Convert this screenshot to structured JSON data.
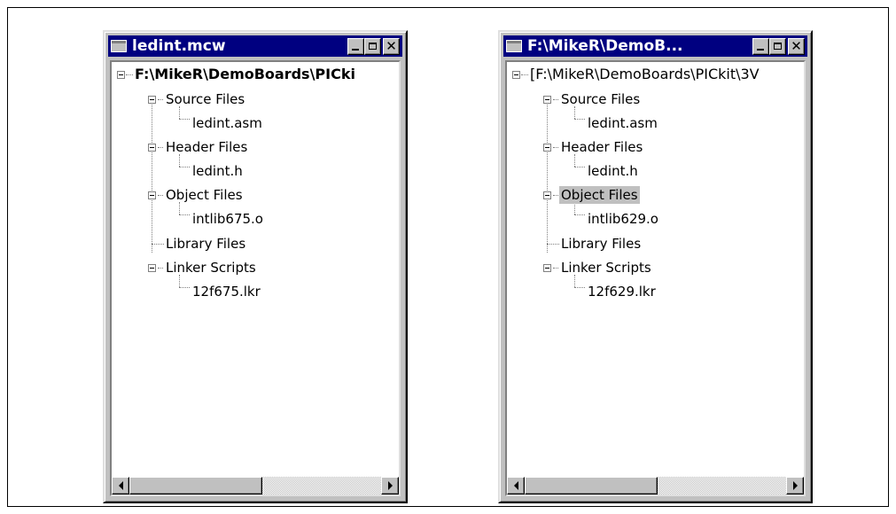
{
  "windows": [
    {
      "title": "ledint.mcw",
      "root": "F:\\MikeR\\DemoBoards\\PICki",
      "items": [
        "Source Files",
        "ledint.asm",
        "Header Files",
        "ledint.h",
        "Object Files",
        "intlib675.o",
        "Library Files",
        "Linker Scripts",
        "12f675.lkr"
      ]
    },
    {
      "title": "F:\\MikeR\\DemoB...",
      "root": "[F:\\MikeR\\DemoBoards\\PICkit\\3V",
      "items": [
        "Source Files",
        "ledint.asm",
        "Header Files",
        "ledint.h",
        "Object Files",
        "intlib629.o",
        "Library Files",
        "Linker Scripts",
        "12f629.lkr"
      ],
      "selected_item": "Object Files"
    }
  ],
  "icons": {
    "window_icon": "window-icon",
    "minimize": "minimize-icon",
    "maximize": "maximize-icon",
    "close": "close-icon",
    "scroll_left": "arrow-left-icon",
    "scroll_right": "arrow-right-icon"
  },
  "colors": {
    "titlebar": "#000080",
    "chrome": "#c0c0c0",
    "selection": "#c0c0c0"
  }
}
